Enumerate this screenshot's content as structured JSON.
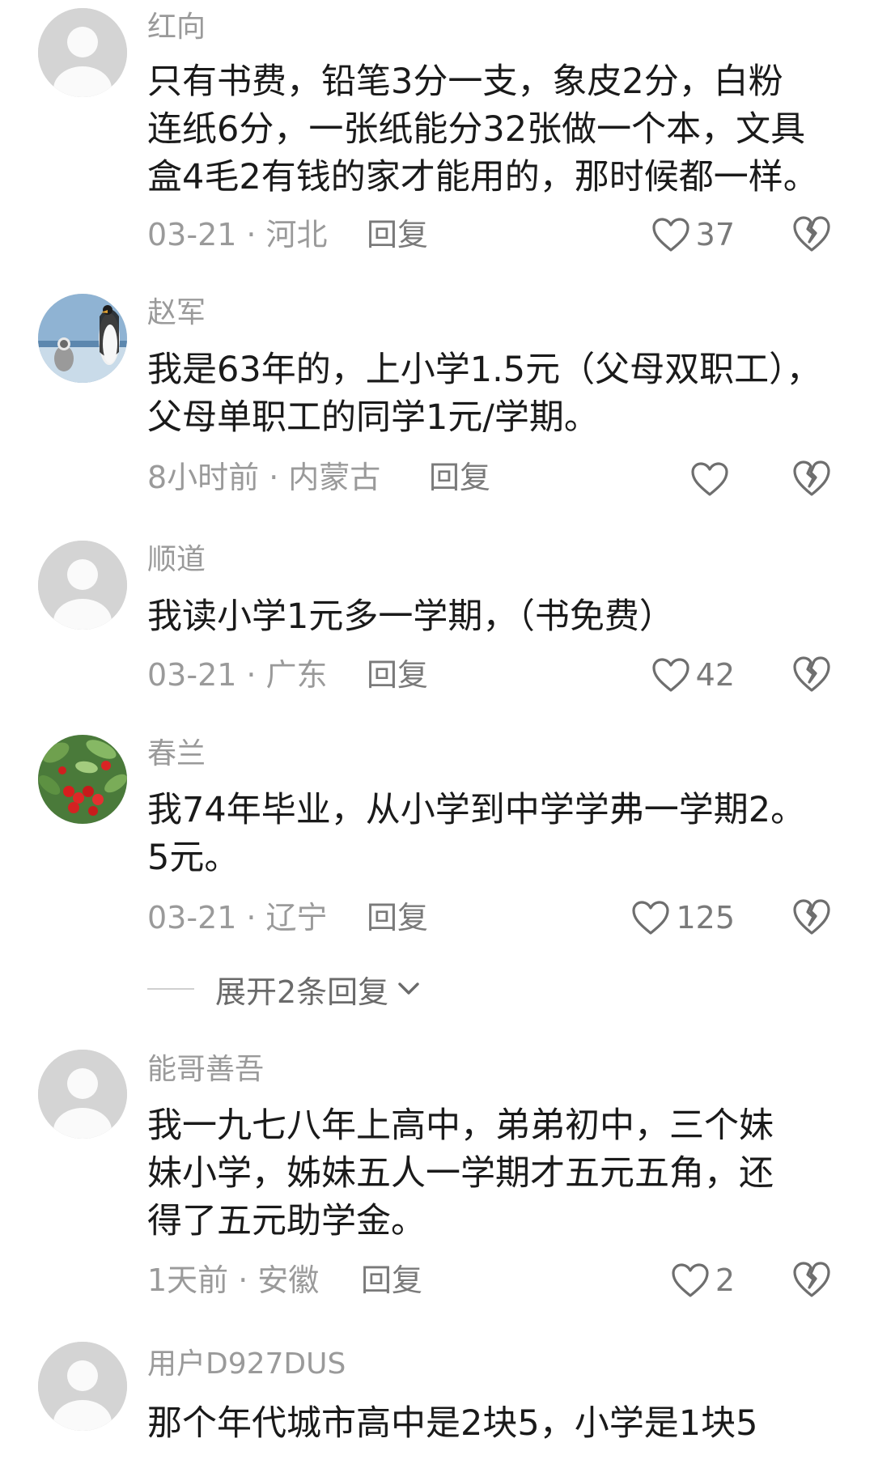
{
  "comments": [
    {
      "username": "红向",
      "lines": [
        "只有书费，铅笔3分一支，象皮2分，白粉",
        "连纸6分，一张纸能分32张做一个本，文具",
        "盒4毛2有钱的家才能用的，那时候都一样。"
      ],
      "time": "03-21",
      "location": "河北",
      "reply_label": "回复",
      "likes": "37"
    },
    {
      "username": "赵军",
      "lines": [
        "我是63年的，上小学1.5元（父母双职工），",
        "父母单职工的同学1元/学期。"
      ],
      "time": "8小时前",
      "location": "内蒙古",
      "reply_label": "回复",
      "likes": ""
    },
    {
      "username": "顺道",
      "lines": [
        "我读小学1元多一学期，（书免费）"
      ],
      "time": "03-21",
      "location": "广东",
      "reply_label": "回复",
      "likes": "42"
    },
    {
      "username": "春兰",
      "lines": [
        "我74年毕业，从小学到中学学弗一学期2。",
        "5元。"
      ],
      "time": "03-21",
      "location": "辽宁",
      "reply_label": "回复",
      "likes": "125"
    },
    {
      "username": "能哥善吾",
      "lines": [
        "我一九七八年上高中，弟弟初中，三个妹",
        "妹小学，姊妹五人一学期才五元五角，还",
        "得了五元助学金。"
      ],
      "time": "1天前",
      "location": "安徽",
      "reply_label": "回复",
      "likes": "2"
    },
    {
      "username": "用户D927DUS",
      "lines": [
        "那个年代城市高中是2块5，小学是1块5"
      ]
    }
  ],
  "expand_replies": {
    "label": "展开2条回复"
  },
  "meta_separator": "·",
  "icons": {
    "like": "heart-outline-icon",
    "dislike": "broken-heart-icon",
    "expand": "chevron-down-icon"
  },
  "colors": {
    "text": "#1a1a1a",
    "secondary": "#9a9a9a",
    "icon": "#6e6e6e",
    "avatar_bg": "#d2d2d2"
  }
}
